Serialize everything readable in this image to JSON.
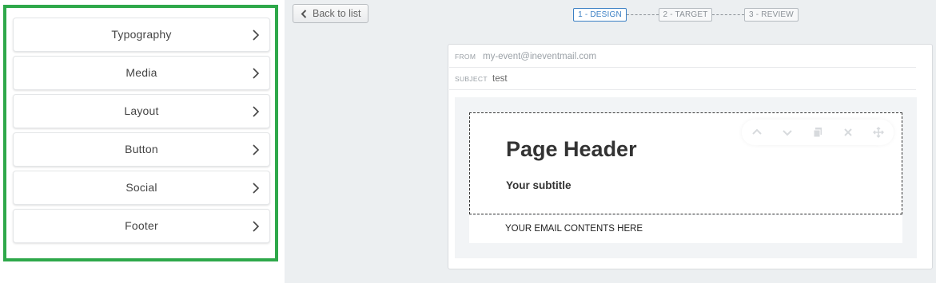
{
  "sidebar": {
    "blocks": [
      {
        "label": "Typography"
      },
      {
        "label": "Media"
      },
      {
        "label": "Layout"
      },
      {
        "label": "Button"
      },
      {
        "label": "Social"
      },
      {
        "label": "Footer"
      }
    ],
    "highlight_color": "#2ea84a",
    "item_icon": "chevron-right-icon"
  },
  "toolbar": {
    "back_label": "Back to list",
    "back_icon": "chevron-left-icon"
  },
  "steps": [
    {
      "label": "1 - DESIGN",
      "active": true
    },
    {
      "label": "2 - TARGET",
      "active": false
    },
    {
      "label": "3 - REVIEW",
      "active": false
    }
  ],
  "step_active_color": "#3a7fc4",
  "email": {
    "from_label": "FROM",
    "from_value": "my-event@ineventmail.com",
    "subject_label": "SUBJECT",
    "subject_value": "test",
    "header_title": "Page Header",
    "header_subtitle": "Your subtitle",
    "body_text": "YOUR EMAIL CONTENTS HERE",
    "block_tools": [
      "move-up-icon",
      "move-down-icon",
      "duplicate-icon",
      "delete-icon",
      "drag-icon"
    ]
  }
}
